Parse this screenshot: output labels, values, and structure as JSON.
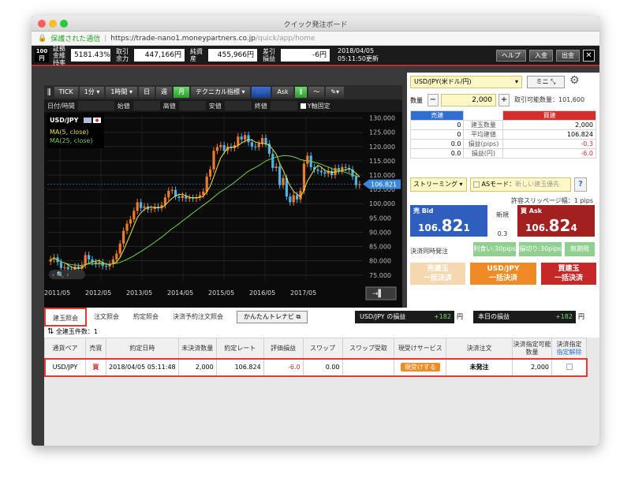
{
  "window": {
    "title": "クイック発注ボード",
    "secure_label": "保護された通信",
    "url_main": "https://trade-nano1.moneypartners.co.jp",
    "url_rest": "/quick/app/home"
  },
  "topbar": {
    "logo_top": "100",
    "logo_bottom": "円",
    "stats": [
      {
        "label": "証拠金維持率",
        "value": "5181.43%",
        "color": "#2e7d32"
      },
      {
        "label": "取引余力",
        "value": "447,166円",
        "color": "#b8860b"
      },
      {
        "label": "純資産",
        "value": "455,966円",
        "color": "#b8860b"
      },
      {
        "label": "差引損益",
        "value": "-6円",
        "color": "#d32f2f"
      }
    ],
    "date": "2018/04/05",
    "time": "05:11:50更新",
    "help": "ヘルプ",
    "deposit": "入金",
    "withdraw": "出金"
  },
  "chart_toolbar": {
    "tick": "TICK",
    "min1": "1分",
    "hour1": "1時間",
    "day": "日",
    "week": "週",
    "month": "月",
    "tech": "テクニカル指標",
    "bid": "Bid",
    "ask": "Ask"
  },
  "ohlc": {
    "datetime": "日付/時間",
    "open": "始値",
    "high": "高値",
    "low": "安値",
    "close": "終値",
    "yfix": "Y軸固定"
  },
  "chart_data": {
    "type": "candlestick",
    "title": "USD/JPY",
    "legend": [
      "MA(5, close)",
      "MA(25, close)"
    ],
    "x_ticks": [
      "2011/05",
      "2012/05",
      "2013/05",
      "2014/05",
      "2015/05",
      "2016/05",
      "2017/05"
    ],
    "y_ticks": [
      "130.000",
      "125.000",
      "120.000",
      "115.000",
      "110.000",
      "105.000",
      "100.000",
      "95.000",
      "90.000",
      "85.000",
      "80.000",
      "75.000"
    ],
    "ylim": [
      73,
      131
    ],
    "current": "106.821",
    "closes": [
      80.5,
      81.2,
      79.5,
      77.5,
      77.8,
      77.0,
      76.8,
      78.0,
      77.2,
      78.5,
      82.0,
      80.5,
      79.5,
      78.8,
      79.5,
      78.2,
      78.0,
      78.8,
      80.5,
      82.5,
      86.0,
      90.5,
      93.0,
      94.5,
      97.5,
      100.5,
      98.5,
      99.0,
      98.0,
      98.2,
      99.0,
      98.5,
      99.5,
      102.2,
      104.5,
      104.8,
      102.5,
      102.0,
      102.8,
      101.8,
      102.0,
      101.8,
      102.2,
      103.0,
      104.2,
      109.5,
      112.0,
      118.5,
      119.8,
      120.5,
      118.5,
      120.0,
      119.5,
      120.5,
      123.5,
      122.5,
      124.0,
      121.5,
      120.0,
      119.8,
      121.0,
      123.0,
      121.0,
      117.5,
      112.5,
      113.0,
      106.5,
      109.0,
      102.5,
      100.5,
      103.0,
      101.5,
      104.5,
      114.0,
      116.8,
      112.8,
      112.0,
      111.5,
      111.0,
      110.5,
      111.5,
      110.0,
      112.5,
      111.5,
      112.8,
      112.5,
      112.0,
      109.5,
      106.5,
      106.8
    ]
  },
  "order": {
    "pair": "USD/JPY(米ドル/円)",
    "mini": "ミニ",
    "qty_label": "数量",
    "qty": "2,000",
    "avail": "取引可能数量：101,600",
    "sell_head": "売建",
    "buy_head": "買建",
    "rows": [
      {
        "label": "建玉数量",
        "sell": "0",
        "buy": "2,000"
      },
      {
        "label": "平均建値",
        "sell": "0",
        "buy": "106.824"
      },
      {
        "label": "損益(pips)",
        "sell": "0.0",
        "buy": "-0.3"
      },
      {
        "label": "損益(円)",
        "sell": "0.0",
        "buy": "-6.0"
      }
    ],
    "streaming": "ストリーミング",
    "asmode": "ASモード：",
    "asmode_sub": "新しい建玉優先",
    "help": "?",
    "slippage": "許容スリッページ幅：1 pips",
    "bid_label": "売 Bid",
    "ask_label": "買 Ask",
    "bid_pre": "106.",
    "bid_big": "82",
    "bid_last": "1",
    "ask_pre": "106.",
    "ask_big": "82",
    "ask_last": "4",
    "spread_label": "新規",
    "spread": "0.3",
    "simul_label": "決済同時発注",
    "rikui": "利食い:30pips",
    "songiri": "損切り:30pips",
    "mukigen": "無期限",
    "sell_settle1": "売建玉",
    "sell_settle2": "一括決済",
    "all_settle1": "USD/JPY",
    "all_settle2": "一括決済",
    "buy_settle1": "買建玉",
    "buy_settle2": "一括決済"
  },
  "bottom": {
    "tabs": [
      "建玉照会",
      "注文照会",
      "約定照会",
      "決済予約注文照会"
    ],
    "navi": "かんたんトレナビ",
    "pl1_label": "USD/JPY の損益",
    "pl1_value": "+182",
    "pl1_unit": "円",
    "pl2_label": "本日の損益",
    "pl2_value": "+182",
    "pl2_unit": "円",
    "count": "全建玉件数：1",
    "headers": [
      "通貨ペア",
      "売買",
      "約定日時",
      "未決済数量",
      "約定レート",
      "評価損益",
      "スワップ",
      "スワップ受取",
      "現受けサービス",
      "決済注文",
      "決済指定可能数量",
      "決済指定"
    ],
    "header_link": "指定解除",
    "row": {
      "pair": "USD/JPY",
      "side": "買",
      "datetime": "2018/04/05 05:11:48",
      "qty": "2,000",
      "rate": "106.824",
      "pl": "-6.0",
      "swap": "0.00",
      "swap_recv": "",
      "genuke": "現受けする",
      "settle": "未発注",
      "avail": "2,000"
    }
  }
}
